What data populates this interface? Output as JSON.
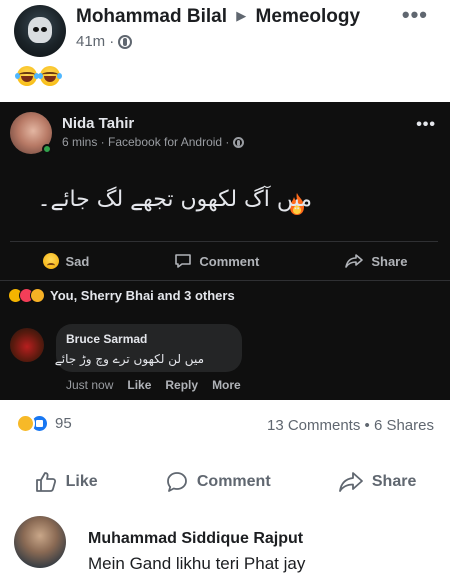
{
  "post": {
    "author": "Mohammad Bilal",
    "group": "Memeology",
    "time": "41m",
    "more_icon": "more-dots-icon",
    "caption_emojis": [
      "laugh-tears-emoji",
      "laugh-tears-emoji"
    ]
  },
  "shared": {
    "name": "Nida Tahir",
    "meta": "6 mins · Facebook for Android ·",
    "text": "میں آگ لکھوں تجھے لگ جائے۔",
    "actions": {
      "sad": "Sad",
      "comment": "Comment",
      "share": "Share"
    },
    "reactions_summary": "You, Sherry Bhai and 3 others",
    "comment": {
      "name": "Bruce Sarmad",
      "text": "میں لن لکھوں ترے وچ وڑ جائے",
      "time": "Just now",
      "like": "Like",
      "reply": "Reply",
      "more": "More"
    }
  },
  "stats": {
    "reactions": "95",
    "comments": "13 Comments",
    "shares": "6 Shares"
  },
  "actions": {
    "like": "Like",
    "comment": "Comment",
    "share": "Share"
  },
  "comment": {
    "name": "Muhammad Siddique Rajput",
    "text": "Mein Gand likhu teri Phat jay"
  },
  "colors": {
    "text_primary": "#1c1e21",
    "text_secondary": "#606770",
    "dark_bg": "#0f0f0f",
    "like_blue": "#1877f2",
    "haha_yellow": "#f7b928"
  }
}
